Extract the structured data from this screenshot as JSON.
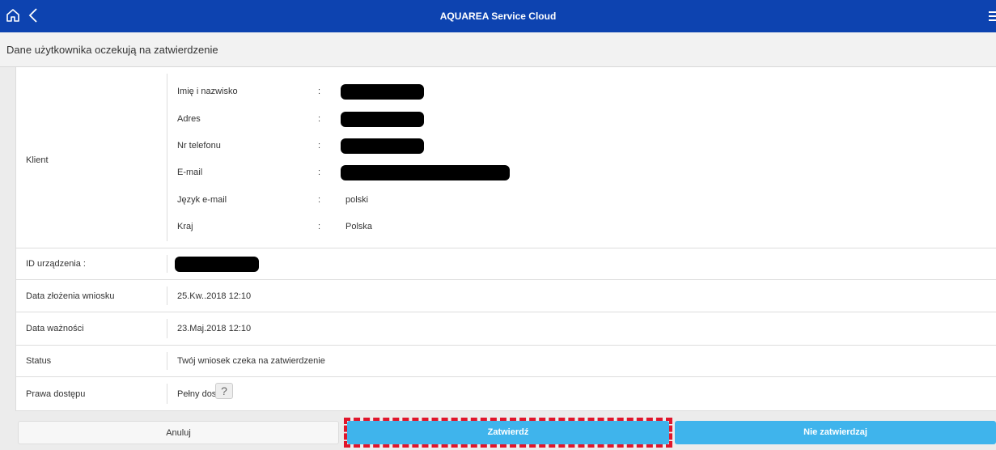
{
  "app": {
    "title": "AQUAREA Service Cloud"
  },
  "icons": {
    "home": "home-icon",
    "back": "chevron-left-icon",
    "menu": "menu-icon"
  },
  "page": {
    "heading": "Dane użytkownika oczekują na zatwierdzenie"
  },
  "client": {
    "label": "Klient",
    "fields": [
      {
        "key": "Imię i nazwisko",
        "colon": ":",
        "value": ""
      },
      {
        "key": "Adres",
        "colon": ":",
        "value": ""
      },
      {
        "key": "Nr telefonu",
        "colon": ":",
        "value": ""
      },
      {
        "key": "E-mail",
        "colon": ":",
        "value": ""
      },
      {
        "key": "Język e-mail",
        "colon": ":",
        "value": "polski"
      },
      {
        "key": "Kraj",
        "colon": ":",
        "value": "Polska"
      }
    ]
  },
  "device": {
    "label": "ID urządzenia :",
    "value": ""
  },
  "submitted": {
    "label": "Data złożenia wniosku",
    "value": "25.Kw..2018 12:10"
  },
  "expiry": {
    "label": "Data ważności",
    "value": "23.Maj.2018 12:10"
  },
  "status": {
    "label": "Status",
    "value": "Twój wniosek czeka na zatwierdzenie",
    "color": "#f0a020"
  },
  "access": {
    "label": "Prawa dostępu",
    "value": "Pełny dostęp",
    "help": "?"
  },
  "buttons": {
    "cancel": "Anuluj",
    "approve": "Zatwierdź",
    "reject": "Nie zatwierdzaj"
  },
  "colors": {
    "topbar": "#0d43b0",
    "accent_button": "#3fb4ec",
    "highlight_frame": "#e0162b"
  }
}
